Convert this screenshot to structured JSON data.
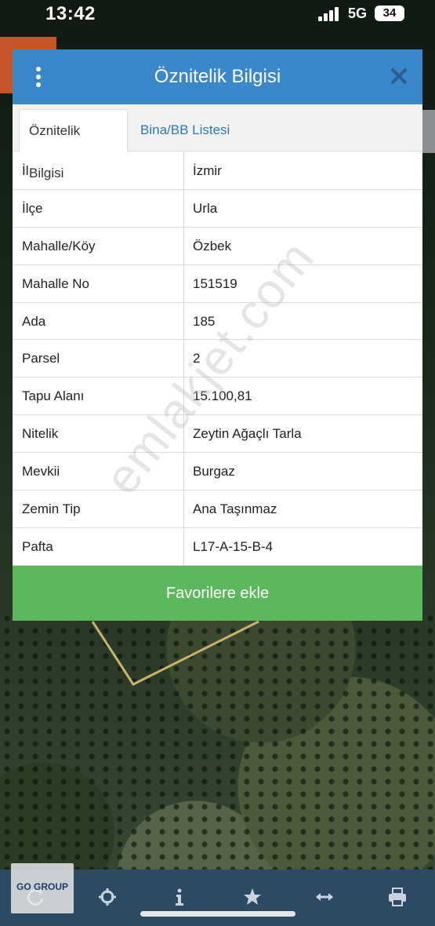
{
  "status_bar": {
    "time": "13:42",
    "network": "5G",
    "battery": "34"
  },
  "dialog": {
    "title": "Öznitelik Bilgisi",
    "tabs": [
      {
        "label": "Öznitelik Bilgisi",
        "active": true
      },
      {
        "label": "Bina/BB Listesi",
        "active": false
      }
    ],
    "rows": [
      {
        "key": "İl",
        "value": "İzmir"
      },
      {
        "key": "İlçe",
        "value": "Urla"
      },
      {
        "key": "Mahalle/Köy",
        "value": "Özbek"
      },
      {
        "key": "Mahalle No",
        "value": "151519"
      },
      {
        "key": "Ada",
        "value": "185"
      },
      {
        "key": "Parsel",
        "value": "2"
      },
      {
        "key": "Tapu Alanı",
        "value": "15.100,81"
      },
      {
        "key": "Nitelik",
        "value": "Zeytin Ağaçlı Tarla"
      },
      {
        "key": "Mevkii",
        "value": "Burgaz"
      },
      {
        "key": "Zemin Tip",
        "value": "Ana Taşınmaz"
      },
      {
        "key": "Pafta",
        "value": "L17-A-15-B-4"
      }
    ],
    "favorite_button": "Favorilere ekle"
  },
  "watermark": "emlakjet.com",
  "logo_text": "GO GROUP",
  "toolbar": {
    "icons": [
      "refresh-icon",
      "crosshair-icon",
      "info-icon",
      "star-icon",
      "measure-arrows-icon",
      "print-icon"
    ]
  },
  "colors": {
    "header": "#3a87c9",
    "button": "#5cb85c",
    "toolbar": "#2c4a63"
  }
}
